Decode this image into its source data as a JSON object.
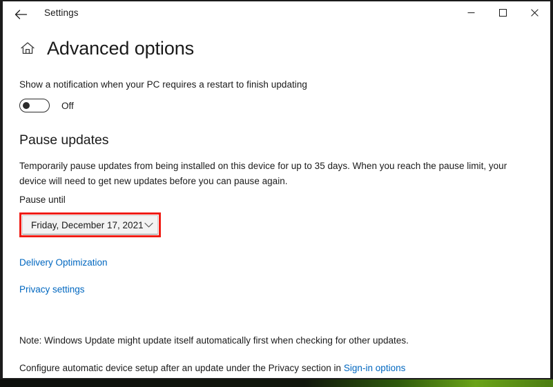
{
  "window": {
    "app_title": "Settings",
    "back_icon": "back-arrow-icon",
    "controls": {
      "minimize": "minimize-icon",
      "maximize": "maximize-icon",
      "close": "close-icon"
    }
  },
  "page": {
    "home_icon": "home-icon",
    "title": "Advanced options",
    "notification_setting": {
      "label": "Show a notification when your PC requires a restart to finish updating",
      "toggle_state": "Off",
      "toggle_on": false
    },
    "pause_updates": {
      "heading": "Pause updates",
      "description": "Temporarily pause updates from being installed on this device for up to 35 days. When you reach the pause limit, your device will need to get new updates before you can pause again.",
      "field_label": "Pause until",
      "selected_date": "Friday, December 17, 2021",
      "chevron_icon": "chevron-down-icon",
      "highlight_color": "#f01c14"
    },
    "links": {
      "delivery_optimization": "Delivery Optimization",
      "privacy_settings": "Privacy settings"
    },
    "footer": {
      "note": "Note: Windows Update might update itself automatically first when checking for other updates.",
      "configure_prefix": "Configure automatic device setup after an update under the Privacy section in ",
      "configure_link": "Sign-in options"
    }
  },
  "theme": {
    "accent_link": "#0067c0",
    "text": "#1a1a1a",
    "surface": "#ffffff"
  }
}
